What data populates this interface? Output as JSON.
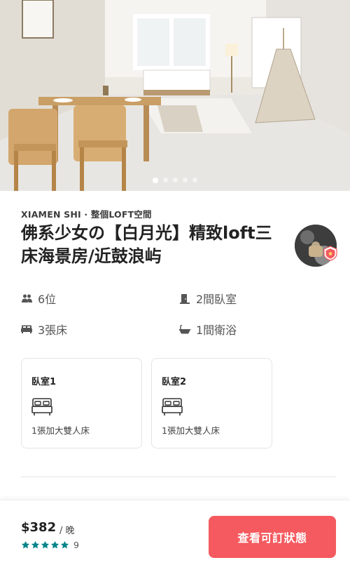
{
  "listing": {
    "location": "XIAMEN SHI · 整個LOFT空間",
    "title": "佛系少女の【白月光】精致loft三床海景房/近鼓浪屿"
  },
  "gallery": {
    "slide_count": 5,
    "active_index": 0
  },
  "amenities": {
    "guests": "6位",
    "bedrooms": "2間臥室",
    "beds": "3張床",
    "baths": "1間衛浴"
  },
  "rooms": [
    {
      "name": "臥室1",
      "bed": "1張加大雙人床"
    },
    {
      "name": "臥室2",
      "bed": "1張加大雙人床"
    }
  ],
  "booking": {
    "price": "$382",
    "per_night": "/ 晚",
    "rating_stars": 5,
    "review_count": "9",
    "cta_label": "查看可訂狀態"
  },
  "colors": {
    "cta": "#f45a5f",
    "stars": "#00848a"
  },
  "icons": {
    "guests": "guests-icon",
    "bedrooms": "door-icon",
    "beds": "bed-icon",
    "baths": "bathtub-icon",
    "superhost": "superhost-badge-icon",
    "star": "star-icon"
  }
}
